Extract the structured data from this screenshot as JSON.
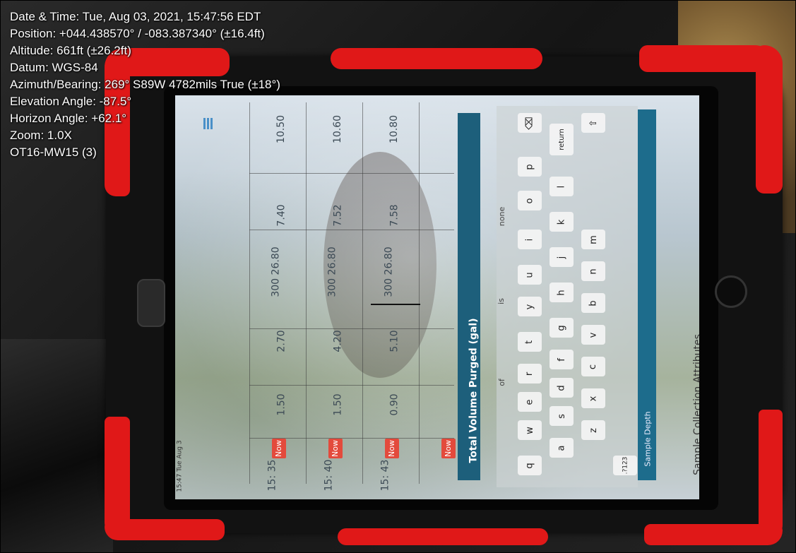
{
  "overlay": {
    "date_time": "Date & Time: Tue, Aug 03, 2021, 15:47:56 EDT",
    "position": "Position: +044.438570° / -083.387340° (±16.4ft)",
    "altitude": "Altitude: 661ft (±26.2ft)",
    "datum": "Datum: WGS-84",
    "azimuth": "Azimuth/Bearing: 269° S89W 4782mils True (±18°)",
    "elevation": "Elevation Angle: -87.5°",
    "horizon": "Horizon Angle: +62.1°",
    "zoom": "Zoom: 1.0X",
    "label": "OT16-MW15 (3)"
  },
  "tablet": {
    "status_time": "15:47 Tue Aug 3",
    "table_rows": [
      {
        "time": "15:\n35",
        "now": "Now",
        "c1": "1.50",
        "c2": "2.70",
        "c3": "300 26.80",
        "c4": "7.40",
        "c5": "10.50"
      },
      {
        "time": "15:\n40",
        "now": "Now",
        "c1": "1.50",
        "c2": "4.20",
        "c3": "300 26.80",
        "c4": "7.52",
        "c5": "10.60"
      },
      {
        "time": "15:\n43",
        "now": "Now",
        "c1": "0.90",
        "c2": "5.10",
        "c3": "300 26.80",
        "c4": "7.58",
        "c5": "10.80"
      },
      {
        "time": "",
        "now": "Now",
        "c1": "",
        "c2": "",
        "c3": "",
        "c4": "",
        "c5": ""
      }
    ],
    "field_label": "Total Volume Purged (gal)",
    "suggestions": [
      "of",
      "is",
      "none"
    ],
    "keys_row1": [
      "q",
      "w",
      "e",
      "r",
      "t",
      "y",
      "u",
      "i",
      "o",
      "p"
    ],
    "keys_row2": [
      "a",
      "s",
      "d",
      "f",
      "g",
      "h",
      "j",
      "k",
      "l"
    ],
    "keys_row3": [
      "z",
      "x",
      "c",
      "v",
      "b",
      "n",
      "m"
    ],
    "key_return": "return",
    "key_123": ".?123",
    "sample_depth": "Sample Depth",
    "section_title": "Sample Collection Attributes"
  },
  "colors": {
    "case_red": "#e01818",
    "teal": "#1d5f7b",
    "now_badge": "#e34a3c"
  }
}
